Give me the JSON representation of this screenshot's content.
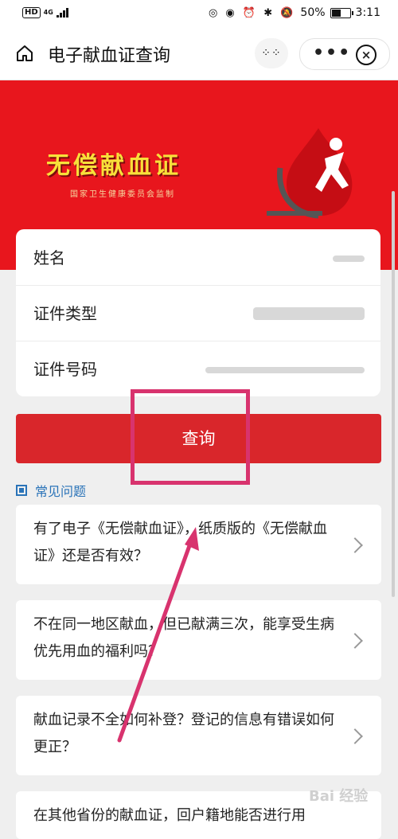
{
  "status_bar": {
    "hd": "HD",
    "network": "4G",
    "signal_icon": "signal-bars-icon",
    "icons": "◎ ◉ ⏰ ✱ 🔕",
    "battery": "50%",
    "time": "3:11"
  },
  "nav": {
    "title": "电子献血证查询",
    "scan_label": "⁘⁘",
    "more_label": "•••",
    "close_label": "×",
    "home_icon": "home-icon"
  },
  "banner": {
    "title": "无偿献血证",
    "subtitle": "国家卫生健康委员会监制"
  },
  "form": {
    "rows": [
      {
        "label": "姓名",
        "value_blurred": true
      },
      {
        "label": "证件类型",
        "value_blurred": true
      },
      {
        "label": "证件号码",
        "value_blurred": true
      }
    ]
  },
  "query_button": "查询",
  "faq": {
    "title": "常见问题",
    "items": [
      "有了电子《无偿献血证》，纸质版的《无偿献血证》还是否有效？",
      "不在同一地区献血，但已献满三次，能享受生病优先用血的福利吗？",
      "献血记录不全如何补登？登记的信息有错误如何更正？",
      "在其他省份的献血证，回户籍地能否进行用"
    ]
  },
  "colors": {
    "primary_red": "#d9262b",
    "banner_red": "#e8161d",
    "accent_blue": "#2a73b8",
    "highlight_pink": "#d8336e"
  },
  "watermark": "Bai 经验"
}
